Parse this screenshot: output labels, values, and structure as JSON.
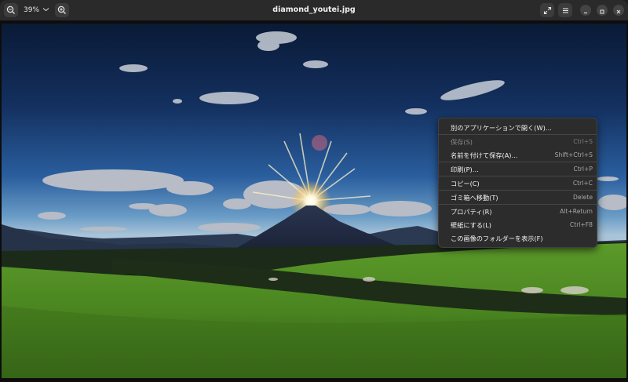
{
  "window": {
    "title": "diamond_youtei.jpg"
  },
  "toolbar": {
    "zoom_out_icon": "zoom-out-icon",
    "zoom_level": "39%",
    "zoom_in_icon": "zoom-in-icon",
    "fullscreen_icon": "fullscreen-icon",
    "menu_icon": "hamburger-menu-icon"
  },
  "window_controls": {
    "minimize": "minimize-icon",
    "maximize": "maximize-icon",
    "close": "close-icon"
  },
  "context_menu": {
    "items": [
      {
        "label": "別のアプリケーションで開く(W)…",
        "accel": "",
        "disabled": false
      },
      {
        "label": "保存(S)",
        "accel": "Ctrl+S",
        "disabled": true
      },
      {
        "label": "名前を付けて保存(A)…",
        "accel": "Shift+Ctrl+S",
        "disabled": false
      },
      {
        "label": "印刷(P)…",
        "accel": "Ctrl+P",
        "disabled": false
      },
      {
        "label": "コピー(C)",
        "accel": "Ctrl+C",
        "disabled": false
      },
      {
        "label": "ゴミ箱へ移動(T)",
        "accel": "Delete",
        "disabled": false
      },
      {
        "label": "プロパティ(R)",
        "accel": "Alt+Return",
        "disabled": false
      },
      {
        "label": "壁紙にする(L)",
        "accel": "Ctrl+F8",
        "disabled": false
      },
      {
        "label": "この画像のフォルダーを表示(F)",
        "accel": "",
        "disabled": false
      }
    ]
  },
  "colors": {
    "headerbar": "#2a2a2a",
    "menu_bg": "#2c2c2c",
    "sky_top": "#0c1c3c",
    "sky_mid": "#1f4f8f",
    "grass": "#4d8a22"
  }
}
